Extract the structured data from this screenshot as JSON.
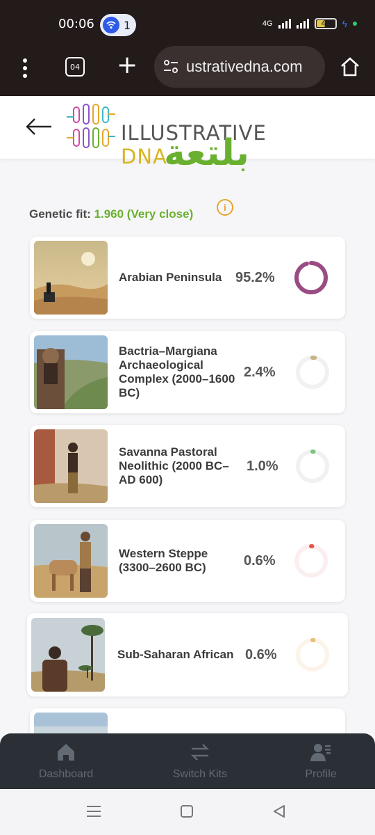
{
  "status_bar": {
    "time": "00:06",
    "notification_count": "1",
    "network": "4G",
    "battery": "45",
    "battery_level": 0.45
  },
  "browser": {
    "tabs_count": "04",
    "url": "ustrativedna.com"
  },
  "header": {
    "logo_text_main": "ILLUSTRATIVE",
    "logo_text_tail": "DNA",
    "arabic_text": "بلتعة"
  },
  "summary": {
    "genetic_fit_label": "Genetic fit:",
    "genetic_fit_value": "1.960 (Very close)"
  },
  "results": [
    {
      "name": "Arabian Peninsula",
      "percent": "95.2%",
      "value": 95.2,
      "color": "#9b4b84"
    },
    {
      "name": "Bactria–Margiana Archaeological Complex (2000–1600 BC)",
      "percent": "2.4%",
      "value": 2.4,
      "color": "#c9b483"
    },
    {
      "name": "Savanna Pastoral Neolithic (2000 BC–AD 600)",
      "percent": "1.0%",
      "value": 1.0,
      "color": "#7cc67a"
    },
    {
      "name": "Western Steppe (3300–2600 BC)",
      "percent": "0.6%",
      "value": 0.6,
      "color": "#e8574a"
    },
    {
      "name": "Sub-Saharan African",
      "percent": "0.6%",
      "value": 0.6,
      "color": "#e7bf7a"
    }
  ],
  "bottom_nav": {
    "dashboard": "Dashboard",
    "switch_kits": "Switch Kits",
    "profile": "Profile"
  }
}
